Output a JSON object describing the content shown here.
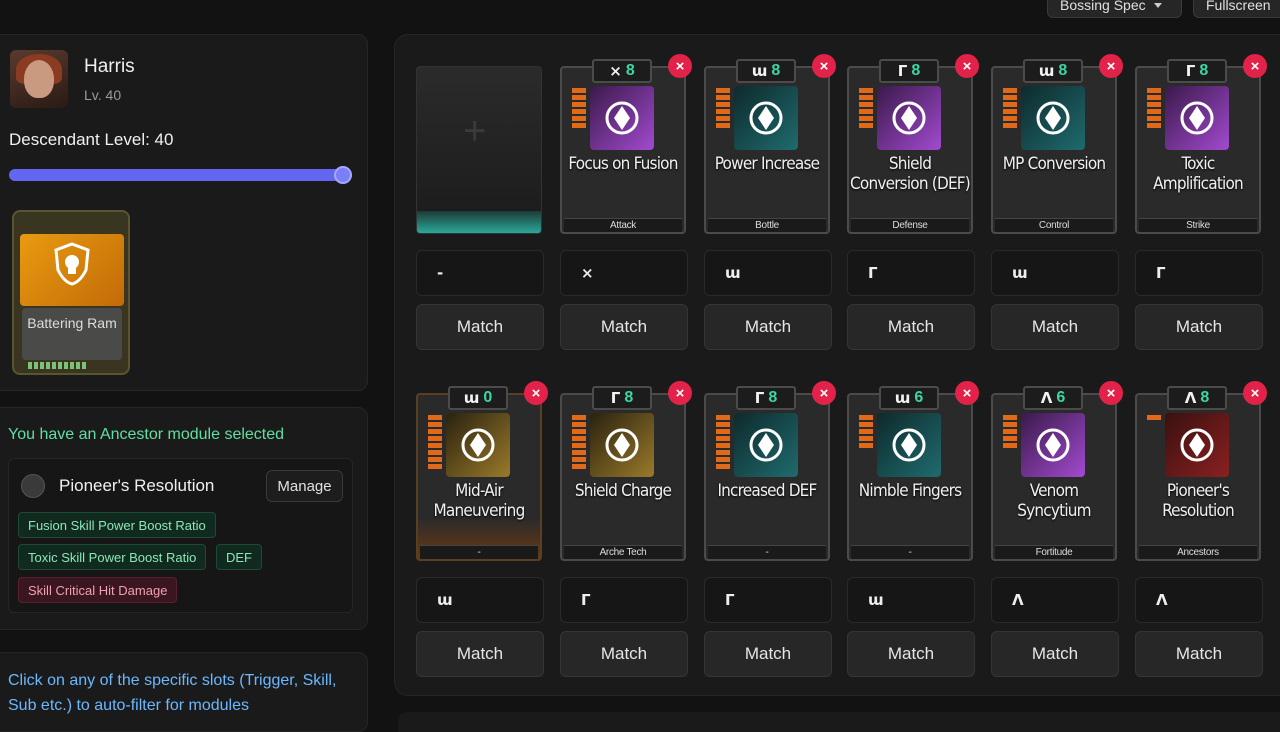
{
  "top": {
    "spec_label": "Bossing Spec",
    "fullscreen_label": "Fullscreen"
  },
  "character": {
    "name": "Harris",
    "level": "Lv. 40",
    "descendant_level": "Descendant Level: 40"
  },
  "equipped_card": {
    "label": "Battering Ram"
  },
  "ancestor": {
    "message": "You have an Ancestor module selected",
    "name": "Pioneer's Resolution",
    "manage_label": "Manage",
    "tags": [
      "Fusion Skill Power Boost Ratio",
      "Toxic Skill Power Boost Ratio",
      "DEF",
      "Skill Critical Hit Damage"
    ]
  },
  "hint": "Click on any of the specific slots (Trigger, Skill, Sub etc.) to auto-filter for modules",
  "slots_row1": [
    {
      "title": "",
      "socket": "-",
      "match": "Match"
    },
    {
      "title": "Focus on Fusion",
      "symbol": "⨯",
      "cost": "8",
      "foot": "Attack",
      "socket": "⨯",
      "match": "Match"
    },
    {
      "title": "Power Increase",
      "symbol": "ɯ",
      "cost": "8",
      "foot": "Bottle",
      "socket": "ɯ",
      "match": "Match"
    },
    {
      "title": "Shield Conversion (DEF)",
      "symbol": "Γ",
      "cost": "8",
      "foot": "Defense",
      "socket": "Γ",
      "match": "Match"
    },
    {
      "title": "MP Conversion",
      "symbol": "ɯ",
      "cost": "8",
      "foot": "Control",
      "socket": "ɯ",
      "match": "Match"
    },
    {
      "title": "Toxic Amplification",
      "symbol": "Γ",
      "cost": "8",
      "foot": "Strike",
      "socket": "Γ",
      "match": "Match"
    }
  ],
  "slots_row2": [
    {
      "title": "Mid-Air Maneuvering",
      "symbol": "ɯ",
      "cost": "0",
      "foot": "-",
      "socket": "ɯ",
      "match": "Match"
    },
    {
      "title": "Shield Charge",
      "symbol": "Γ",
      "cost": "8",
      "foot": "Arche Tech",
      "socket": "Γ",
      "match": "Match"
    },
    {
      "title": "Increased DEF",
      "symbol": "Γ",
      "cost": "8",
      "foot": "-",
      "socket": "Γ",
      "match": "Match"
    },
    {
      "title": "Nimble Fingers",
      "symbol": "ɯ",
      "cost": "6",
      "foot": "-",
      "socket": "ɯ",
      "match": "Match"
    },
    {
      "title": "Venom Syncytium",
      "symbol": "Λ",
      "cost": "6",
      "foot": "Fortitude",
      "socket": "Λ",
      "match": "Match"
    },
    {
      "title": "Pioneer's Resolution",
      "symbol": "Λ",
      "cost": "8",
      "foot": "Ancestors",
      "socket": "Λ",
      "match": "Match"
    }
  ],
  "colors": {
    "accent": "#6366f1",
    "cost": "#3ed6a0",
    "close": "#e3224a",
    "ancestor_text": "#5ee0a0",
    "hint": "#6ab8ff"
  },
  "icons": {
    "close": "×"
  }
}
